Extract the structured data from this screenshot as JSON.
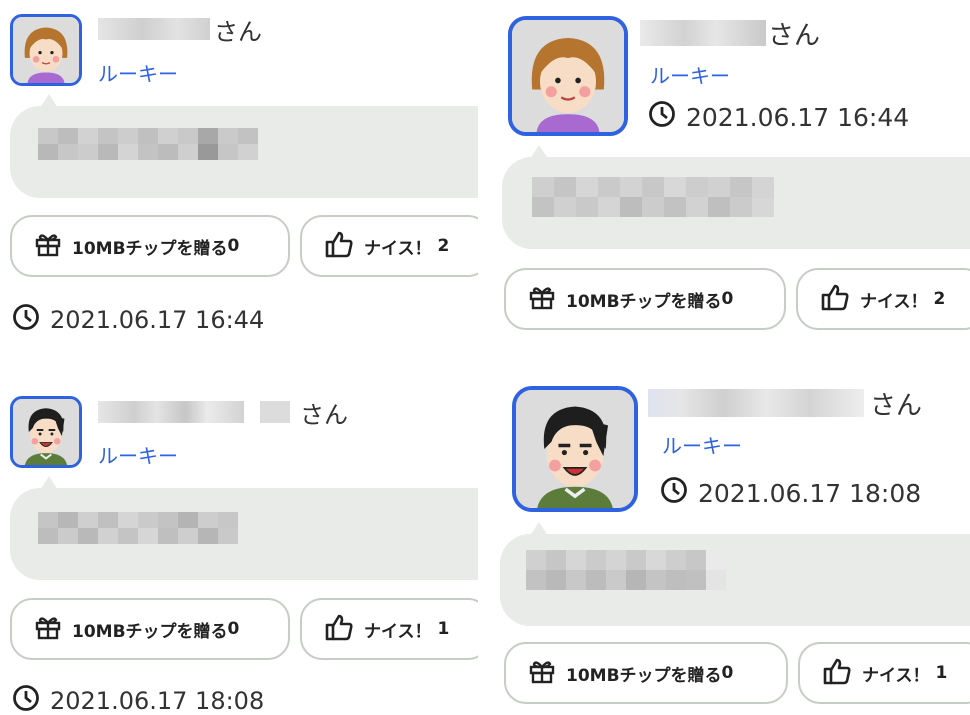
{
  "posts": [
    {
      "honorific": "さん",
      "rank": "ルーキー",
      "timestamp": "2021.06.17 16:44",
      "tip_label": "10MBチップを贈る",
      "tip_count": "0",
      "nice_label": "ナイス！",
      "nice_count": "2",
      "avatar": "woman-avatar-icon"
    },
    {
      "honorific": "さん",
      "rank": "ルーキー",
      "timestamp": "2021.06.17 16:44",
      "tip_label": "10MBチップを贈る",
      "tip_count": "0",
      "nice_label": "ナイス！",
      "nice_count": "2",
      "avatar": "woman-avatar-icon"
    },
    {
      "honorific": "さん",
      "rank": "ルーキー",
      "timestamp": "2021.06.17 18:08",
      "tip_label": "10MBチップを贈る",
      "tip_count": "0",
      "nice_label": "ナイス！",
      "nice_count": "1",
      "avatar": "man-avatar-icon"
    },
    {
      "honorific": "さん",
      "rank": "ルーキー",
      "timestamp": "2021.06.17 18:08",
      "tip_label": "10MBチップを贈る",
      "tip_count": "0",
      "nice_label": "ナイス！",
      "nice_count": "1",
      "avatar": "man-avatar-icon"
    }
  ],
  "colors": {
    "accent": "#2f62e0",
    "bubble": "#e8ebe8",
    "pill_border": "#c5cdc5"
  }
}
